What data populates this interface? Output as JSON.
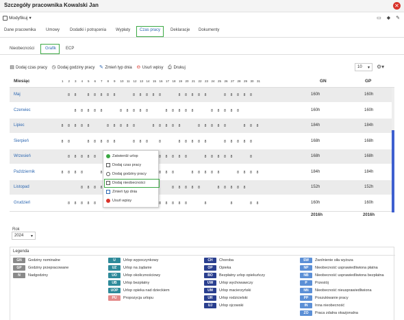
{
  "window": {
    "title": "Szczegóły pracownika Kowalski Jan"
  },
  "modbar": {
    "button": "Modyfikuj"
  },
  "tabs": [
    "Dane pracownika",
    "Umowy",
    "Dodatki i potrącenia",
    "Wypłaty",
    "Czas pracy",
    "Deklaracje",
    "Dokumenty"
  ],
  "subtabs": [
    "Nieobecności",
    "Grafik",
    "ECP"
  ],
  "toolbar": {
    "add_time": "Dodaj czas pracy",
    "add_hours": "Dodaj godziny pracy",
    "change_day": "Zmień typ dnia",
    "delete": "Usuń wpisy",
    "print": "Drukuj"
  },
  "pager": {
    "value": "10"
  },
  "grid": {
    "header_month": "Miesiąc",
    "header_gn": "GN",
    "header_gp": "GP",
    "days": [
      "1",
      "2",
      "3",
      "4",
      "5",
      "6",
      "7",
      "8",
      "9",
      "10",
      "11",
      "12",
      "13",
      "14",
      "15",
      "16",
      "17",
      "18",
      "19",
      "20",
      "21",
      "22",
      "23",
      "24",
      "25",
      "26",
      "27",
      "28",
      "29",
      "30",
      "31"
    ],
    "rows": [
      {
        "month": "Maj",
        "gn": "160h",
        "gp": "160h"
      },
      {
        "month": "Czerwiec",
        "gn": "160h",
        "gp": "160h"
      },
      {
        "month": "Lipiec",
        "gn": "184h",
        "gp": "184h"
      },
      {
        "month": "Sierpień",
        "gn": "168h",
        "gp": "168h"
      },
      {
        "month": "Wrzesień",
        "gn": "168h",
        "gp": "168h"
      },
      {
        "month": "Październik",
        "gn": "184h",
        "gp": "184h"
      },
      {
        "month": "Listopad",
        "gn": "152h",
        "gp": "152h"
      },
      {
        "month": "Grudzień",
        "gn": "160h",
        "gp": "160h"
      }
    ],
    "cell_value": "8",
    "total_gn": "2016h",
    "total_gp": "2016h"
  },
  "context_menu": [
    "Zatwierdź urlop",
    "Dodaj czas pracy",
    "Dodaj godziny pracy",
    "Dodaj nieobecności",
    "Zmień typ dnia",
    "Usuń wpisy"
  ],
  "year": {
    "label": "Rok",
    "value": "2024"
  },
  "legend": {
    "title": "Legenda",
    "items": [
      {
        "code": "GN",
        "label": "Godziny nominalne",
        "color": "#8a8a8a"
      },
      {
        "code": "GP",
        "label": "Godziny przepracowane",
        "color": "#8a8a8a"
      },
      {
        "code": "N",
        "label": "Nadgodziny",
        "color": "#8a8a8a"
      },
      {
        "code": "U",
        "label": "Urlop wypoczynkowy",
        "color": "#2e8a9a"
      },
      {
        "code": "UZ",
        "label": "Urlop na żądanie",
        "color": "#2e8a9a"
      },
      {
        "code": "UO",
        "label": "Urlop okolicznościowy",
        "color": "#2e8a9a"
      },
      {
        "code": "UB",
        "label": "Urlop bezpłatny",
        "color": "#2e8a9a"
      },
      {
        "code": "UOP",
        "label": "Urlop opieka nad dzieckiem",
        "color": "#2e8a9a"
      },
      {
        "code": "PU",
        "label": "Propozycja urlopu",
        "color": "#e48a8a"
      },
      {
        "code": "CH",
        "label": "Choroba",
        "color": "#2a3f8f"
      },
      {
        "code": "OP",
        "label": "Opieka",
        "color": "#2a3f8f"
      },
      {
        "code": "BO",
        "label": "Bezpłatny urlop opiekuńczy",
        "color": "#2a3f8f"
      },
      {
        "code": "UW",
        "label": "Urlop wychowawczy",
        "color": "#2a3f8f"
      },
      {
        "code": "UM",
        "label": "Urlop macierzyński",
        "color": "#2a3f8f"
      },
      {
        "code": "UR",
        "label": "Urlop rodzicielski",
        "color": "#2a3f8f"
      },
      {
        "code": "UJ",
        "label": "Urlop ojcowski",
        "color": "#2a3f8f"
      },
      {
        "code": "SW",
        "label": "Zwolnienie siła wyższa",
        "color": "#5b8fd6"
      },
      {
        "code": "NP",
        "label": "Nieobecność usprawiedliwiona płatna",
        "color": "#5b8fd6"
      },
      {
        "code": "NB",
        "label": "Nieobecność usprawiedliwiona bezpłatna",
        "color": "#5b8fd6"
      },
      {
        "code": "P",
        "label": "Przestój",
        "color": "#5b8fd6"
      },
      {
        "code": "NN",
        "label": "Nieobecność nieusprawiedliwiona",
        "color": "#5b8fd6"
      },
      {
        "code": "PP",
        "label": "Poszukiwanie pracy",
        "color": "#5b8fd6"
      },
      {
        "code": "IN",
        "label": "Inna nieobecność",
        "color": "#5b8fd6"
      },
      {
        "code": "ZO",
        "label": "Praca zdalna okazjonalna",
        "color": "#5b8fd6"
      }
    ]
  }
}
